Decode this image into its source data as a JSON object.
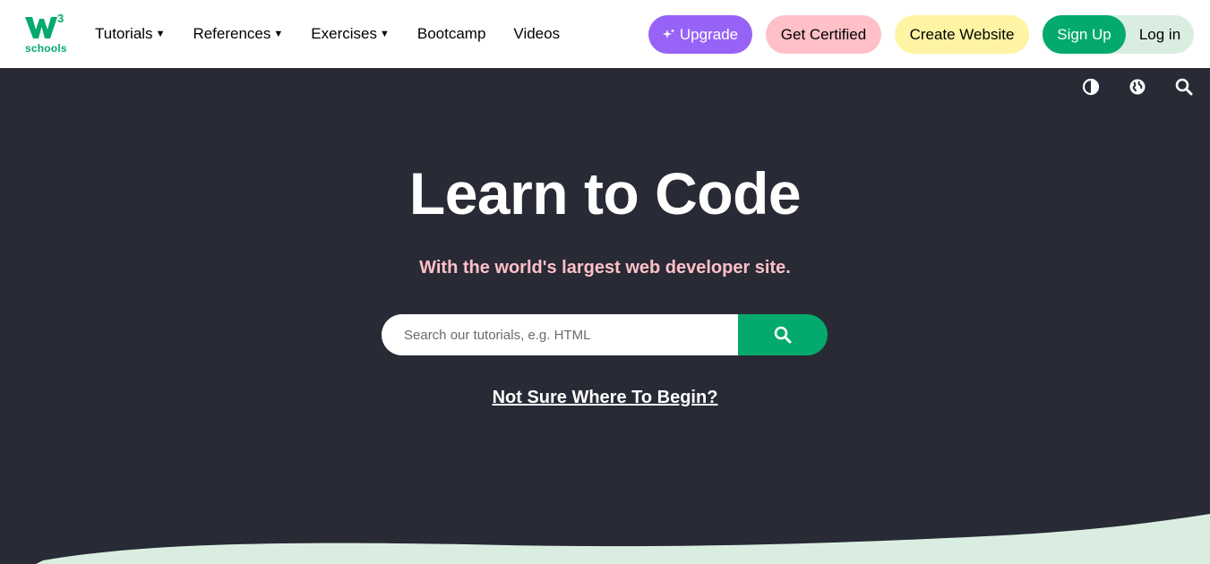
{
  "brand": {
    "name": "W",
    "superscript": "3",
    "sub": "schools",
    "accent": "#04aa6d"
  },
  "nav": {
    "items": [
      {
        "label": "Tutorials",
        "has_dropdown": true
      },
      {
        "label": "References",
        "has_dropdown": true
      },
      {
        "label": "Exercises",
        "has_dropdown": true
      },
      {
        "label": "Bootcamp",
        "has_dropdown": false
      },
      {
        "label": "Videos",
        "has_dropdown": false
      }
    ],
    "caret": "▼"
  },
  "buttons": {
    "upgrade": "Upgrade",
    "get_certified": "Get Certified",
    "create_website": "Create Website",
    "sign_up": "Sign Up",
    "log_in": "Log in"
  },
  "toolbar": {
    "icons": [
      "contrast-icon",
      "globe-icon",
      "search-icon"
    ]
  },
  "hero": {
    "title": "Learn to Code",
    "subtitle": "With the world's largest web developer site.",
    "search_placeholder": "Search our tutorials, e.g. HTML",
    "begin_link": "Not Sure Where To Begin?"
  },
  "colors": {
    "background": "#282a35",
    "upgrade": "#9763f6",
    "certified": "#ffc0c7",
    "create": "#fff4a3",
    "signup": "#04aa6d",
    "login_bg": "#d9eee1",
    "wave": "#d9eee1"
  }
}
